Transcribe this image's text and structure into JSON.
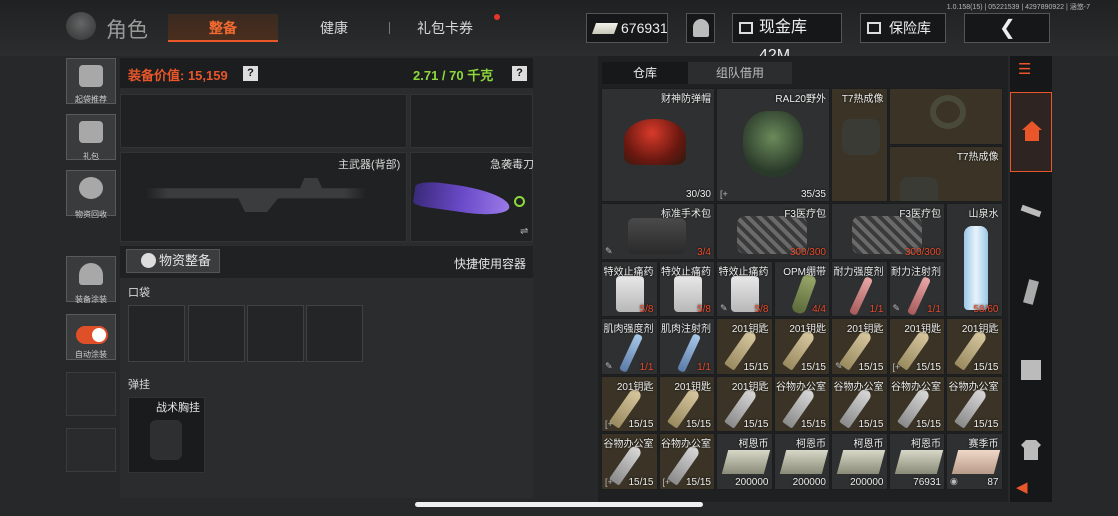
{
  "build_info": "1.0.158(15) | 05221539 | 4297890922 | 涵悠-7",
  "header": {
    "title": "角色",
    "tabs": [
      "整备",
      "健康",
      "礼包卡券"
    ],
    "money": "676931",
    "cash_vault": "现金库 42M",
    "vault": "保险库"
  },
  "left_nav": [
    {
      "label": "起袋推荐",
      "icon": "backpack-recommend-icon"
    },
    {
      "label": "礼包",
      "icon": "gift-icon"
    },
    {
      "label": "物资回收",
      "icon": "recycle-icon"
    },
    {
      "label": "装备涂装",
      "icon": "helmet-paint-icon"
    },
    {
      "label": "自动涂装",
      "icon": "toggle-icon"
    }
  ],
  "equipment": {
    "value_label": "装备价值: 15,159",
    "weight": "2.71 / 70 千克",
    "primary_weapon_label": "主武器(背部)",
    "melee_label": "急袭毒刀",
    "supply_button": "物资整备",
    "quick_use": "快捷使用容器",
    "pocket_label": "口袋",
    "rig_section_label": "弹挂",
    "rig_slot_label": "战术胸挂"
  },
  "storage": {
    "tabs": [
      "仓库",
      "组队借用"
    ],
    "items": [
      {
        "name": "财神防弹帽",
        "count": "30/30"
      },
      {
        "name": "RAL20野外",
        "count": "35/35"
      },
      {
        "name": "T7热成像",
        "count": ""
      },
      {
        "name": "",
        "count": ""
      },
      {
        "name": "T7热成像",
        "count": ""
      },
      {
        "name": "标准手术包",
        "count": "3/4"
      },
      {
        "name": "F3医疗包",
        "count": "300/300"
      },
      {
        "name": "F3医疗包",
        "count": "300/300"
      },
      {
        "name": "山泉水",
        "count": "58/60"
      },
      {
        "name": "特效止痛药",
        "count": "5/8"
      },
      {
        "name": "特效止痛药",
        "count": "5/8"
      },
      {
        "name": "特效止痛药",
        "count": "5/8"
      },
      {
        "name": "OPM绷带",
        "count": "4/4"
      },
      {
        "name": "耐力强度剂",
        "count": "1/1"
      },
      {
        "name": "耐力注射剂",
        "count": "1/1"
      },
      {
        "name": "肌肉强度剂",
        "count": "1/1"
      },
      {
        "name": "肌肉注射剂",
        "count": "1/1"
      },
      {
        "name": "201钥匙",
        "count": "15/15"
      },
      {
        "name": "201钥匙",
        "count": "15/15"
      },
      {
        "name": "201钥匙",
        "count": "15/15"
      },
      {
        "name": "201钥匙",
        "count": "15/15"
      },
      {
        "name": "201钥匙",
        "count": "15/15"
      },
      {
        "name": "201钥匙",
        "count": "15/15"
      },
      {
        "name": "201钥匙",
        "count": "15/15"
      },
      {
        "name": "201钥匙",
        "count": "15/15"
      },
      {
        "name": "谷物办公室",
        "count": "15/15"
      },
      {
        "name": "谷物办公室",
        "count": "15/15"
      },
      {
        "name": "谷物办公室",
        "count": "15/15"
      },
      {
        "name": "谷物办公室",
        "count": "15/15"
      },
      {
        "name": "谷物办公室",
        "count": "15/15"
      },
      {
        "name": "谷物办公室",
        "count": "15/15"
      },
      {
        "name": "柯恩币",
        "count": "200000"
      },
      {
        "name": "柯恩币",
        "count": "200000"
      },
      {
        "name": "柯恩币",
        "count": "200000"
      },
      {
        "name": "柯恩币",
        "count": "76931"
      },
      {
        "name": "赛季币",
        "count": "87"
      }
    ]
  },
  "colors": {
    "accent": "#e8562a",
    "weight_ok": "#8ed83c",
    "count_warning": "#e84a2a"
  }
}
